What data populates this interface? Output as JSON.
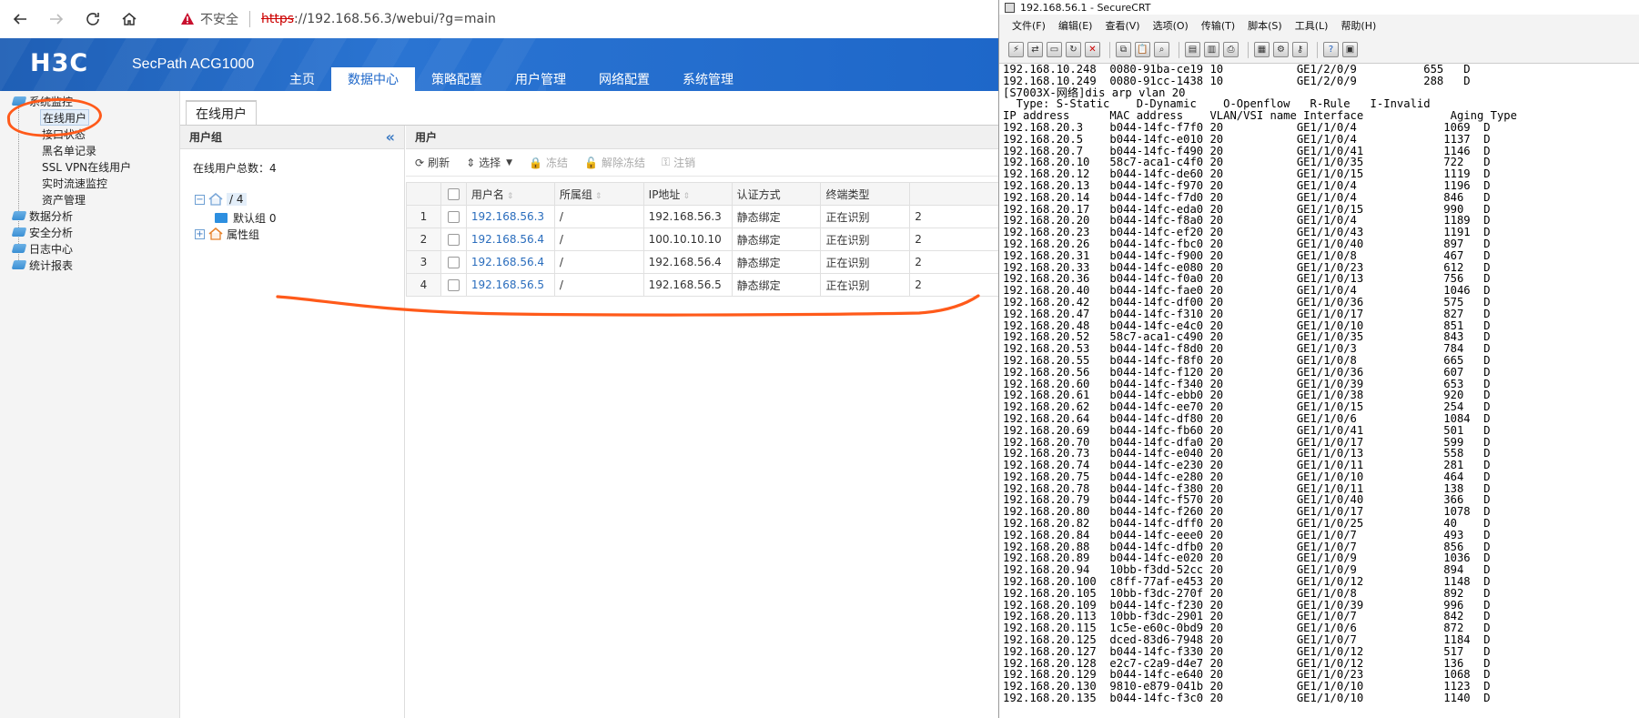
{
  "browser": {
    "security_warning": "不安全",
    "url_scheme": "https",
    "url_rest": "://192.168.56.3/webui/?g=main"
  },
  "app": {
    "logo": "H3C",
    "product": "SecPath ACG1000",
    "nav_tabs": [
      "主页",
      "数据中心",
      "策略配置",
      "用户管理",
      "网络配置",
      "系统管理"
    ],
    "active_tab": 1
  },
  "sidebar": {
    "sections": [
      {
        "label": "系统监控",
        "children": [
          "在线用户",
          "接口状态",
          "黑名单记录",
          "SSL VPN在线用户",
          "实时流速监控",
          "资产管理"
        ]
      },
      {
        "label": "数据分析",
        "children": []
      },
      {
        "label": "安全分析",
        "children": []
      },
      {
        "label": "日志中心",
        "children": []
      },
      {
        "label": "统计报表",
        "children": []
      }
    ],
    "selected": "在线用户"
  },
  "content": {
    "page_tab": "在线用户",
    "group_panel": {
      "title": "用户组",
      "total_label": "在线用户总数：4",
      "root_label": "/ 4",
      "default_group": "默认组 0",
      "attr_group": "属性组"
    },
    "users_panel": {
      "title": "用户",
      "toolbar": [
        {
          "label": "刷新",
          "enabled": true,
          "icon": "refresh-icon"
        },
        {
          "label": "选择",
          "enabled": true,
          "icon": "sort-icon"
        },
        {
          "label": "冻结",
          "enabled": false,
          "icon": "lock-icon"
        },
        {
          "label": "解除冻结",
          "enabled": false,
          "icon": "unlock-icon"
        },
        {
          "label": "注销",
          "enabled": false,
          "icon": "key-icon"
        }
      ],
      "columns": [
        "用户名",
        "所属组",
        "IP地址",
        "认证方式",
        "终端类型"
      ],
      "rows": [
        {
          "no": "1",
          "user": "192.168.56.3",
          "group": "/",
          "ip": "192.168.56.3",
          "auth": "静态绑定",
          "terminal": "正在识别",
          "extra": "2"
        },
        {
          "no": "2",
          "user": "192.168.56.4",
          "group": "/",
          "ip": "100.10.10.10",
          "auth": "静态绑定",
          "terminal": "正在识别",
          "extra": "2"
        },
        {
          "no": "3",
          "user": "192.168.56.4",
          "group": "/",
          "ip": "192.168.56.4",
          "auth": "静态绑定",
          "terminal": "正在识别",
          "extra": "2"
        },
        {
          "no": "4",
          "user": "192.168.56.5",
          "group": "/",
          "ip": "192.168.56.5",
          "auth": "静态绑定",
          "terminal": "正在识别",
          "extra": "2"
        }
      ]
    }
  },
  "securecrt": {
    "title": "192.168.56.1 - SecureCRT",
    "menu": [
      "文件(F)",
      "编辑(E)",
      "查看(V)",
      "选项(O)",
      "传输(T)",
      "脚本(S)",
      "工具(L)",
      "帮助(H)"
    ],
    "terminal_lines": [
      "192.168.10.248  0080-91ba-ce19 10           GE1/2/0/9          655   D",
      "192.168.10.249  0080-91cc-1438 10           GE1/2/0/9          288   D",
      "[S7003X-网络]dis arp vlan 20",
      "  Type: S-Static    D-Dynamic    O-Openflow   R-Rule   I-Invalid",
      "IP address      MAC address    VLAN/VSI name Interface             Aging Type",
      "192.168.20.3    b044-14fc-f7f0 20           GE1/1/0/4             1069  D",
      "192.168.20.5    b044-14fc-e010 20           GE1/1/0/4             1137  D",
      "192.168.20.7    b044-14fc-f490 20           GE1/1/0/41            1146  D",
      "192.168.20.10   58c7-aca1-c4f0 20           GE1/1/0/35            722   D",
      "192.168.20.12   b044-14fc-de60 20           GE1/1/0/15            1119  D",
      "192.168.20.13   b044-14fc-f970 20           GE1/1/0/4             1196  D",
      "192.168.20.14   b044-14fc-f7d0 20           GE1/1/0/4             846   D",
      "192.168.20.17   b044-14fc-eda0 20           GE1/1/0/15            990   D",
      "192.168.20.20   b044-14fc-f8a0 20           GE1/1/0/4             1189  D",
      "192.168.20.23   b044-14fc-ef20 20           GE1/1/0/43            1191  D",
      "192.168.20.26   b044-14fc-fbc0 20           GE1/1/0/40            897   D",
      "192.168.20.31   b044-14fc-f900 20           GE1/1/0/8             467   D",
      "192.168.20.33   b044-14fc-e080 20           GE1/1/0/23            612   D",
      "192.168.20.36   b044-14fc-f0a0 20           GE1/1/0/13            756   D",
      "192.168.20.40   b044-14fc-fae0 20           GE1/1/0/4             1046  D",
      "192.168.20.42   b044-14fc-df00 20           GE1/1/0/36            575   D",
      "192.168.20.47   b044-14fc-f310 20           GE1/1/0/17            827   D",
      "192.168.20.48   b044-14fc-e4c0 20           GE1/1/0/10            851   D",
      "192.168.20.52   58c7-aca1-c490 20           GE1/1/0/35            843   D",
      "192.168.20.53   b044-14fc-f8d0 20           GE1/1/0/3             784   D",
      "192.168.20.55   b044-14fc-f8f0 20           GE1/1/0/8             665   D",
      "192.168.20.56   b044-14fc-f120 20           GE1/1/0/36            607   D",
      "192.168.20.60   b044-14fc-f340 20           GE1/1/0/39            653   D",
      "192.168.20.61   b044-14fc-ebb0 20           GE1/1/0/38            920   D",
      "192.168.20.62   b044-14fc-ee70 20           GE1/1/0/15            254   D",
      "192.168.20.64   b044-14fc-df80 20           GE1/1/0/6             1084  D",
      "192.168.20.69   b044-14fc-fb60 20           GE1/1/0/41            501   D",
      "192.168.20.70   b044-14fc-dfa0 20           GE1/1/0/17            599   D",
      "192.168.20.73   b044-14fc-e040 20           GE1/1/0/13            558   D",
      "192.168.20.74   b044-14fc-e230 20           GE1/1/0/11            281   D",
      "192.168.20.75   b044-14fc-e280 20           GE1/1/0/10            464   D",
      "192.168.20.78   b044-14fc-f380 20           GE1/1/0/11            138   D",
      "192.168.20.79   b044-14fc-f570 20           GE1/1/0/40            366   D",
      "192.168.20.80   b044-14fc-f260 20           GE1/1/0/17            1078  D",
      "192.168.20.82   b044-14fc-dff0 20           GE1/1/0/25            40    D",
      "192.168.20.84   b044-14fc-eee0 20           GE1/1/0/7             493   D",
      "192.168.20.88   b044-14fc-dfb0 20           GE1/1/0/7             856   D",
      "192.168.20.89   b044-14fc-e020 20           GE1/1/0/9             1036  D",
      "192.168.20.94   10bb-f3dd-52cc 20           GE1/1/0/9             894   D",
      "192.168.20.100  c8ff-77af-e453 20           GE1/1/0/12            1148  D",
      "192.168.20.105  10bb-f3dc-270f 20           GE1/1/0/8             892   D",
      "192.168.20.109  b044-14fc-f230 20           GE1/1/0/39            996   D",
      "192.168.20.113  10bb-f3dc-2901 20           GE1/1/0/7             842   D",
      "192.168.20.115  1c5e-e60c-0bd9 20           GE1/1/0/6             872   D",
      "192.168.20.125  dced-83d6-7948 20           GE1/1/0/7             1184  D",
      "192.168.20.127  b044-14fc-f330 20           GE1/1/0/12            517   D",
      "192.168.20.128  e2c7-c2a9-d4e7 20           GE1/1/0/12            136   D",
      "192.168.20.129  b044-14fc-e640 20           GE1/1/0/23            1068  D",
      "192.168.20.130  9810-e879-041b 20           GE1/1/0/10            1123  D",
      "192.168.20.135  b044-14fc-f3c0 20           GE1/1/0/10            1140  D"
    ]
  },
  "colors": {
    "brand_blue": "#1e67c9",
    "annotation_orange": "#ff5a1a",
    "link": "#2a6dbd"
  }
}
